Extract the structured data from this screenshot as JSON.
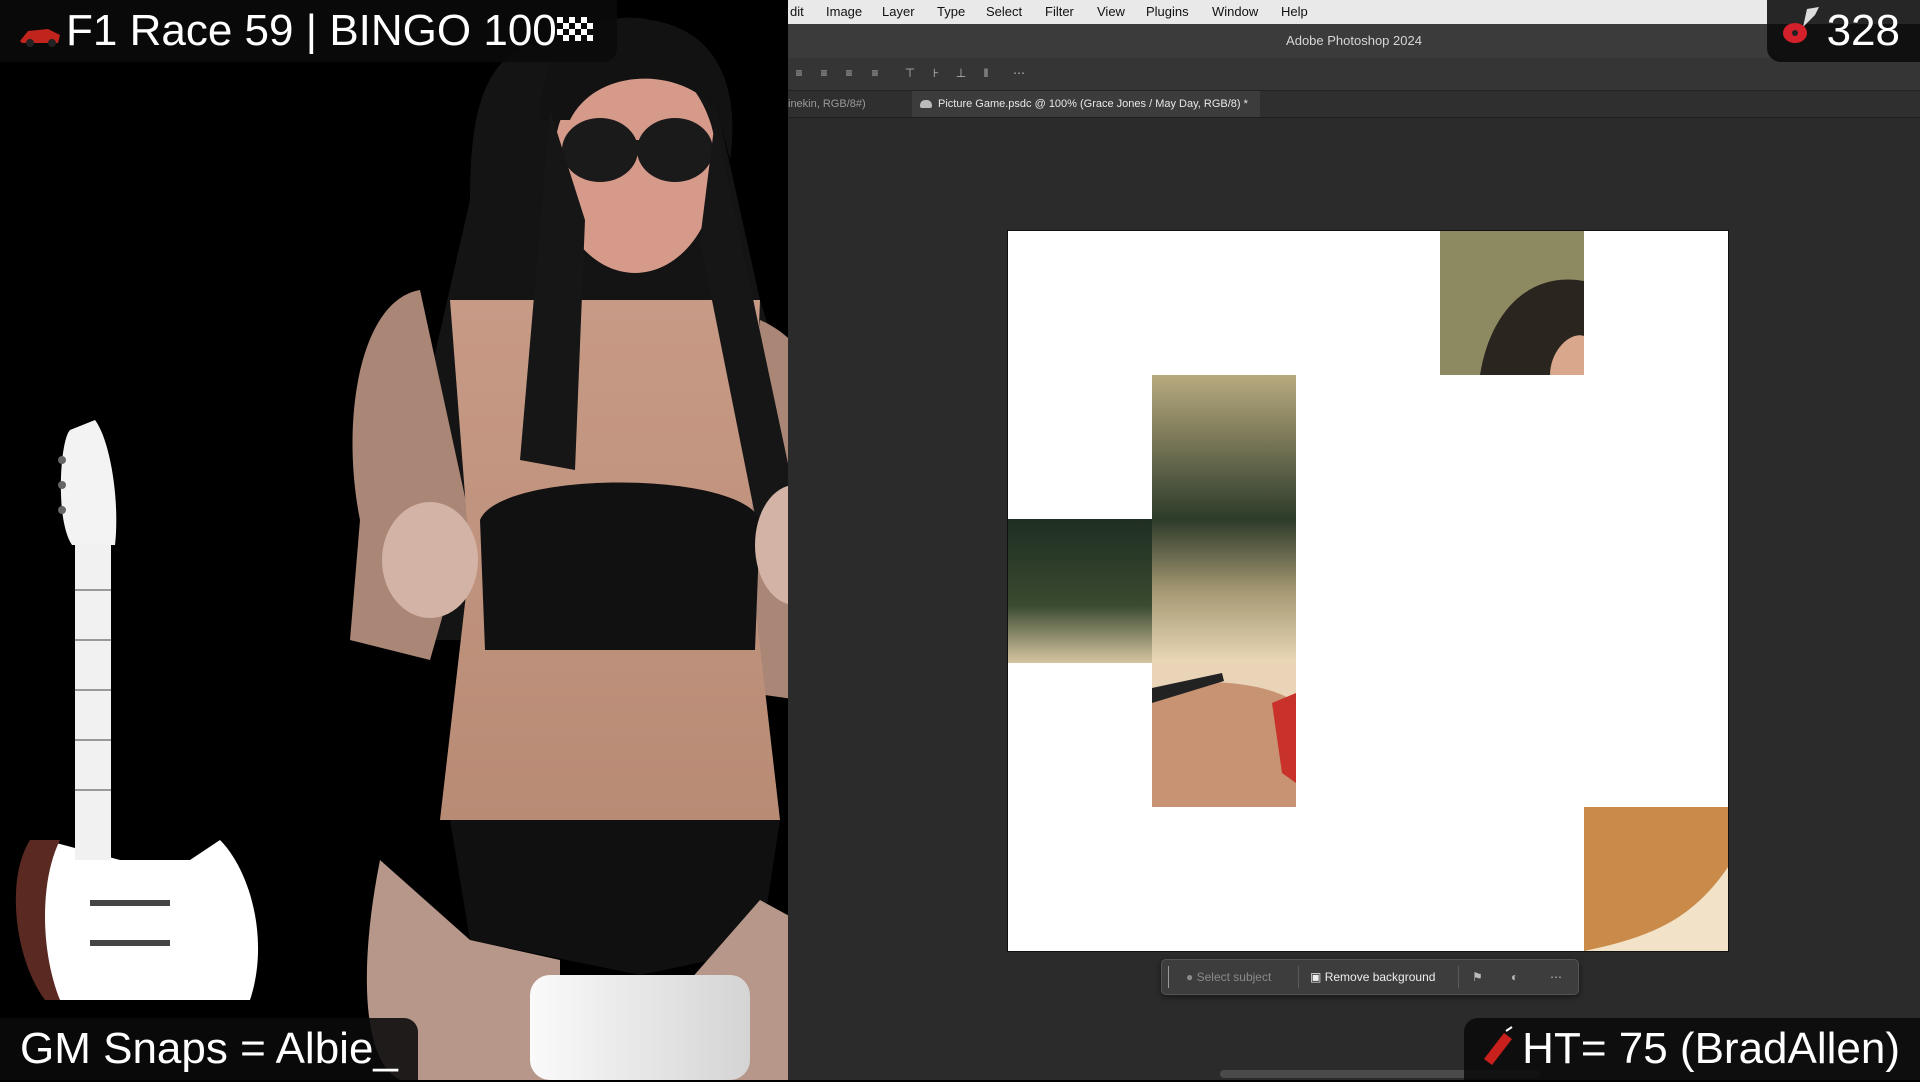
{
  "overlays": {
    "race_title": "F1 Race 59 | BINGO 100",
    "counter": "328",
    "gm_snaps": "GM Snaps = Albie_",
    "high_total": "HT= 75 (BradAllen)"
  },
  "photoshop": {
    "menu": [
      "dit",
      "Image",
      "Layer",
      "Type",
      "Select",
      "Filter",
      "View",
      "Plugins",
      "Window",
      "Help"
    ],
    "app_title": "Adobe Photoshop 2024",
    "tabs": {
      "inactive": "inekin, RGB/8#)",
      "active": "Picture Game.psdc @ 100% (Grace Jones / May Day, RGB/8) *"
    },
    "context_bar": {
      "select_subject": "Select subject",
      "remove_background": "Remove background"
    }
  },
  "icons": [
    "race-car-icon",
    "checkered-flag-icon",
    "guitar-icon",
    "firework-icon",
    "cloud-doc-icon",
    "person-icon",
    "image-icon",
    "flag-icon",
    "mask-icon",
    "more-icon"
  ],
  "colors": {
    "overlay_bg": "#0a0a0a",
    "ps_workspace": "#2b2b2b",
    "ps_menubar": "#e9e9e9",
    "canvas": "#ffffff"
  }
}
